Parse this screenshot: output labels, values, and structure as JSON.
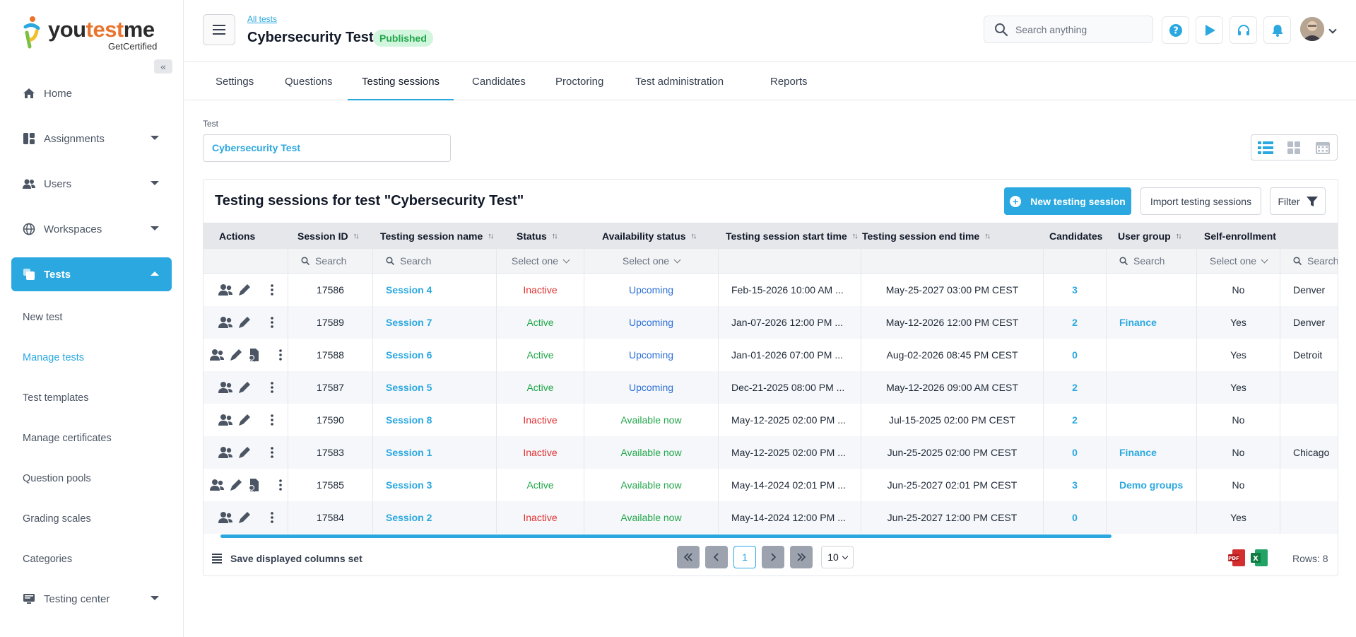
{
  "brand": {
    "name_part1": "you",
    "name_part2": "test",
    "name_part3": "me",
    "sub": "GetCertified"
  },
  "sidebar": {
    "collapse_label": "«",
    "items": [
      {
        "label": "Home",
        "icon": "home-icon"
      },
      {
        "label": "Assignments",
        "icon": "assignments-icon"
      },
      {
        "label": "Users",
        "icon": "users-icon"
      },
      {
        "label": "Workspaces",
        "icon": "globe-icon"
      },
      {
        "label": "Tests",
        "icon": "tests-icon"
      }
    ],
    "subitems": [
      {
        "label": "New test"
      },
      {
        "label": "Manage tests"
      },
      {
        "label": "Test templates"
      },
      {
        "label": "Manage certificates"
      },
      {
        "label": "Question pools"
      },
      {
        "label": "Grading scales"
      },
      {
        "label": "Categories"
      }
    ],
    "testing_center": {
      "label": "Testing center",
      "icon": "monitor-icon"
    }
  },
  "header": {
    "breadcrumb": "All tests",
    "title": "Cybersecurity Test",
    "badge": "Published",
    "search_placeholder": "Search anything"
  },
  "tabs": [
    "Settings",
    "Questions",
    "Testing sessions",
    "Candidates",
    "Proctoring",
    "Test administration",
    "Reports"
  ],
  "test_field": {
    "label": "Test",
    "value": "Cybersecurity Test"
  },
  "panel": {
    "title": "Testing sessions for test \"Cybersecurity Test\"",
    "new_button": "New testing session",
    "import_button": "Import testing sessions",
    "filter_button": "Filter"
  },
  "table": {
    "columns": [
      "Actions",
      "Session ID",
      "Testing session name",
      "Status",
      "Availability status",
      "Testing session start time",
      "Testing session end time",
      "Candidates",
      "User group",
      "Self-enrollment"
    ],
    "filter_search": "Search",
    "filter_select": "Select one",
    "rows": [
      {
        "id": "17586",
        "name": "Session 4",
        "status": "Inactive",
        "availability": "Upcoming",
        "start": "Feb-15-2026 10:00 AM ...",
        "end": "May-25-2027 03:00 PM CEST",
        "candidates": "3",
        "group": "",
        "self": "No",
        "location": "Denver",
        "extra_icon": false
      },
      {
        "id": "17589",
        "name": "Session 7",
        "status": "Active",
        "availability": "Upcoming",
        "start": "Jan-07-2026 12:00 PM ...",
        "end": "May-12-2026 12:00 PM CEST",
        "candidates": "2",
        "group": "Finance",
        "self": "Yes",
        "location": "Denver",
        "extra_icon": false
      },
      {
        "id": "17588",
        "name": "Session 6",
        "status": "Active",
        "availability": "Upcoming",
        "start": "Jan-01-2026 07:00 PM ...",
        "end": "Aug-02-2026 08:45 PM CEST",
        "candidates": "0",
        "group": "",
        "self": "Yes",
        "location": "Detroit",
        "extra_icon": true
      },
      {
        "id": "17587",
        "name": "Session 5",
        "status": "Active",
        "availability": "Upcoming",
        "start": "Dec-21-2025 08:00 PM ...",
        "end": "May-12-2026 09:00 AM CEST",
        "candidates": "2",
        "group": "",
        "self": "Yes",
        "location": "",
        "extra_icon": false
      },
      {
        "id": "17590",
        "name": "Session 8",
        "status": "Inactive",
        "availability": "Available now",
        "start": "May-12-2025 02:00 PM ...",
        "end": "Jul-15-2025 02:00 PM CEST",
        "candidates": "2",
        "group": "",
        "self": "No",
        "location": "",
        "extra_icon": false
      },
      {
        "id": "17583",
        "name": "Session 1",
        "status": "Inactive",
        "availability": "Available now",
        "start": "May-12-2025 02:00 PM ...",
        "end": "Jun-25-2025 02:00 PM CEST",
        "candidates": "0",
        "group": "Finance",
        "self": "No",
        "location": "Chicago",
        "extra_icon": false
      },
      {
        "id": "17585",
        "name": "Session 3",
        "status": "Active",
        "availability": "Available now",
        "start": "May-14-2024 02:01 PM ...",
        "end": "Jun-25-2027 02:01 PM CEST",
        "candidates": "3",
        "group": "Demo groups",
        "self": "No",
        "location": "",
        "extra_icon": true
      },
      {
        "id": "17584",
        "name": "Session 2",
        "status": "Inactive",
        "availability": "Available now",
        "start": "May-14-2024 12:00 PM ...",
        "end": "Jun-25-2027 12:00 PM CEST",
        "candidates": "0",
        "group": "",
        "self": "Yes",
        "location": "",
        "extra_icon": false
      }
    ]
  },
  "footer": {
    "save_columns": "Save displayed columns set",
    "current_page": "1",
    "page_size": "10",
    "rows_count": "Rows: 8"
  },
  "colors": {
    "accent": "#2ba8e0",
    "active": "#22a74a",
    "inactive": "#e03131",
    "upcoming": "#2b6fd6"
  }
}
